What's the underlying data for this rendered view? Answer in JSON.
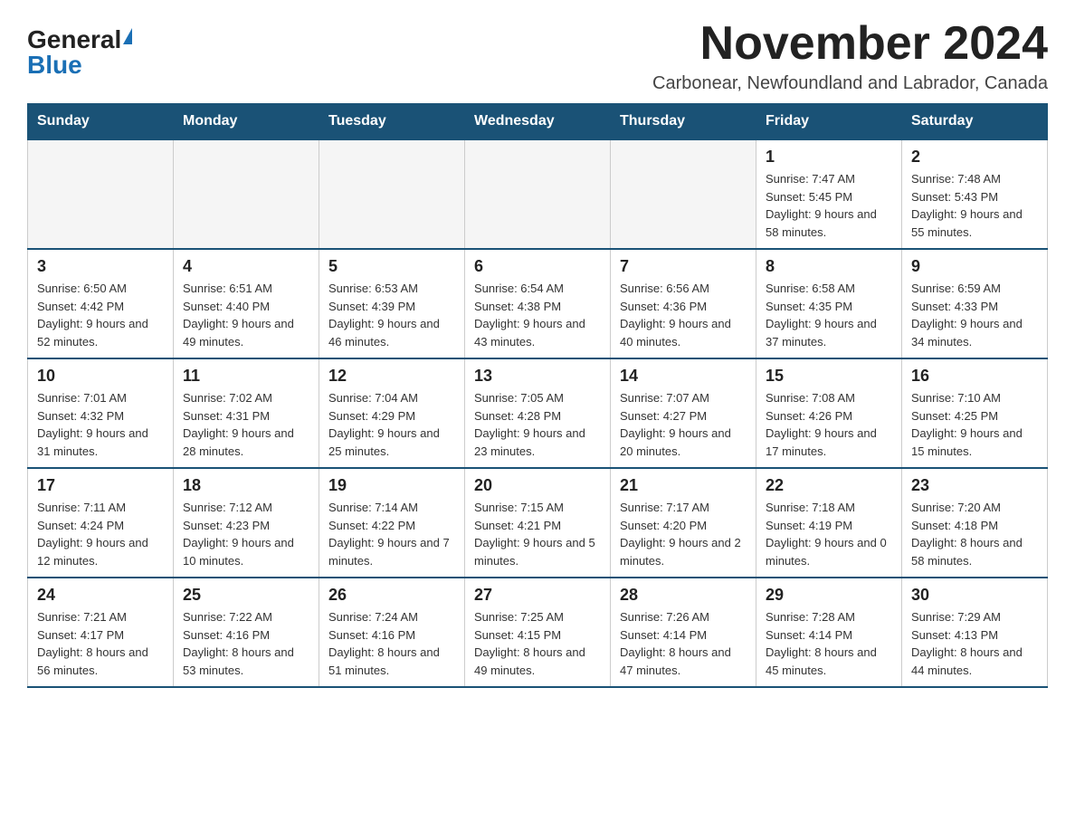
{
  "logo": {
    "general": "General",
    "blue": "Blue"
  },
  "title": "November 2024",
  "subtitle": "Carbonear, Newfoundland and Labrador, Canada",
  "days_of_week": [
    "Sunday",
    "Monday",
    "Tuesday",
    "Wednesday",
    "Thursday",
    "Friday",
    "Saturday"
  ],
  "weeks": [
    [
      {
        "day": "",
        "info": ""
      },
      {
        "day": "",
        "info": ""
      },
      {
        "day": "",
        "info": ""
      },
      {
        "day": "",
        "info": ""
      },
      {
        "day": "",
        "info": ""
      },
      {
        "day": "1",
        "info": "Sunrise: 7:47 AM\nSunset: 5:45 PM\nDaylight: 9 hours and 58 minutes."
      },
      {
        "day": "2",
        "info": "Sunrise: 7:48 AM\nSunset: 5:43 PM\nDaylight: 9 hours and 55 minutes."
      }
    ],
    [
      {
        "day": "3",
        "info": "Sunrise: 6:50 AM\nSunset: 4:42 PM\nDaylight: 9 hours and 52 minutes."
      },
      {
        "day": "4",
        "info": "Sunrise: 6:51 AM\nSunset: 4:40 PM\nDaylight: 9 hours and 49 minutes."
      },
      {
        "day": "5",
        "info": "Sunrise: 6:53 AM\nSunset: 4:39 PM\nDaylight: 9 hours and 46 minutes."
      },
      {
        "day": "6",
        "info": "Sunrise: 6:54 AM\nSunset: 4:38 PM\nDaylight: 9 hours and 43 minutes."
      },
      {
        "day": "7",
        "info": "Sunrise: 6:56 AM\nSunset: 4:36 PM\nDaylight: 9 hours and 40 minutes."
      },
      {
        "day": "8",
        "info": "Sunrise: 6:58 AM\nSunset: 4:35 PM\nDaylight: 9 hours and 37 minutes."
      },
      {
        "day": "9",
        "info": "Sunrise: 6:59 AM\nSunset: 4:33 PM\nDaylight: 9 hours and 34 minutes."
      }
    ],
    [
      {
        "day": "10",
        "info": "Sunrise: 7:01 AM\nSunset: 4:32 PM\nDaylight: 9 hours and 31 minutes."
      },
      {
        "day": "11",
        "info": "Sunrise: 7:02 AM\nSunset: 4:31 PM\nDaylight: 9 hours and 28 minutes."
      },
      {
        "day": "12",
        "info": "Sunrise: 7:04 AM\nSunset: 4:29 PM\nDaylight: 9 hours and 25 minutes."
      },
      {
        "day": "13",
        "info": "Sunrise: 7:05 AM\nSunset: 4:28 PM\nDaylight: 9 hours and 23 minutes."
      },
      {
        "day": "14",
        "info": "Sunrise: 7:07 AM\nSunset: 4:27 PM\nDaylight: 9 hours and 20 minutes."
      },
      {
        "day": "15",
        "info": "Sunrise: 7:08 AM\nSunset: 4:26 PM\nDaylight: 9 hours and 17 minutes."
      },
      {
        "day": "16",
        "info": "Sunrise: 7:10 AM\nSunset: 4:25 PM\nDaylight: 9 hours and 15 minutes."
      }
    ],
    [
      {
        "day": "17",
        "info": "Sunrise: 7:11 AM\nSunset: 4:24 PM\nDaylight: 9 hours and 12 minutes."
      },
      {
        "day": "18",
        "info": "Sunrise: 7:12 AM\nSunset: 4:23 PM\nDaylight: 9 hours and 10 minutes."
      },
      {
        "day": "19",
        "info": "Sunrise: 7:14 AM\nSunset: 4:22 PM\nDaylight: 9 hours and 7 minutes."
      },
      {
        "day": "20",
        "info": "Sunrise: 7:15 AM\nSunset: 4:21 PM\nDaylight: 9 hours and 5 minutes."
      },
      {
        "day": "21",
        "info": "Sunrise: 7:17 AM\nSunset: 4:20 PM\nDaylight: 9 hours and 2 minutes."
      },
      {
        "day": "22",
        "info": "Sunrise: 7:18 AM\nSunset: 4:19 PM\nDaylight: 9 hours and 0 minutes."
      },
      {
        "day": "23",
        "info": "Sunrise: 7:20 AM\nSunset: 4:18 PM\nDaylight: 8 hours and 58 minutes."
      }
    ],
    [
      {
        "day": "24",
        "info": "Sunrise: 7:21 AM\nSunset: 4:17 PM\nDaylight: 8 hours and 56 minutes."
      },
      {
        "day": "25",
        "info": "Sunrise: 7:22 AM\nSunset: 4:16 PM\nDaylight: 8 hours and 53 minutes."
      },
      {
        "day": "26",
        "info": "Sunrise: 7:24 AM\nSunset: 4:16 PM\nDaylight: 8 hours and 51 minutes."
      },
      {
        "day": "27",
        "info": "Sunrise: 7:25 AM\nSunset: 4:15 PM\nDaylight: 8 hours and 49 minutes."
      },
      {
        "day": "28",
        "info": "Sunrise: 7:26 AM\nSunset: 4:14 PM\nDaylight: 8 hours and 47 minutes."
      },
      {
        "day": "29",
        "info": "Sunrise: 7:28 AM\nSunset: 4:14 PM\nDaylight: 8 hours and 45 minutes."
      },
      {
        "day": "30",
        "info": "Sunrise: 7:29 AM\nSunset: 4:13 PM\nDaylight: 8 hours and 44 minutes."
      }
    ]
  ]
}
